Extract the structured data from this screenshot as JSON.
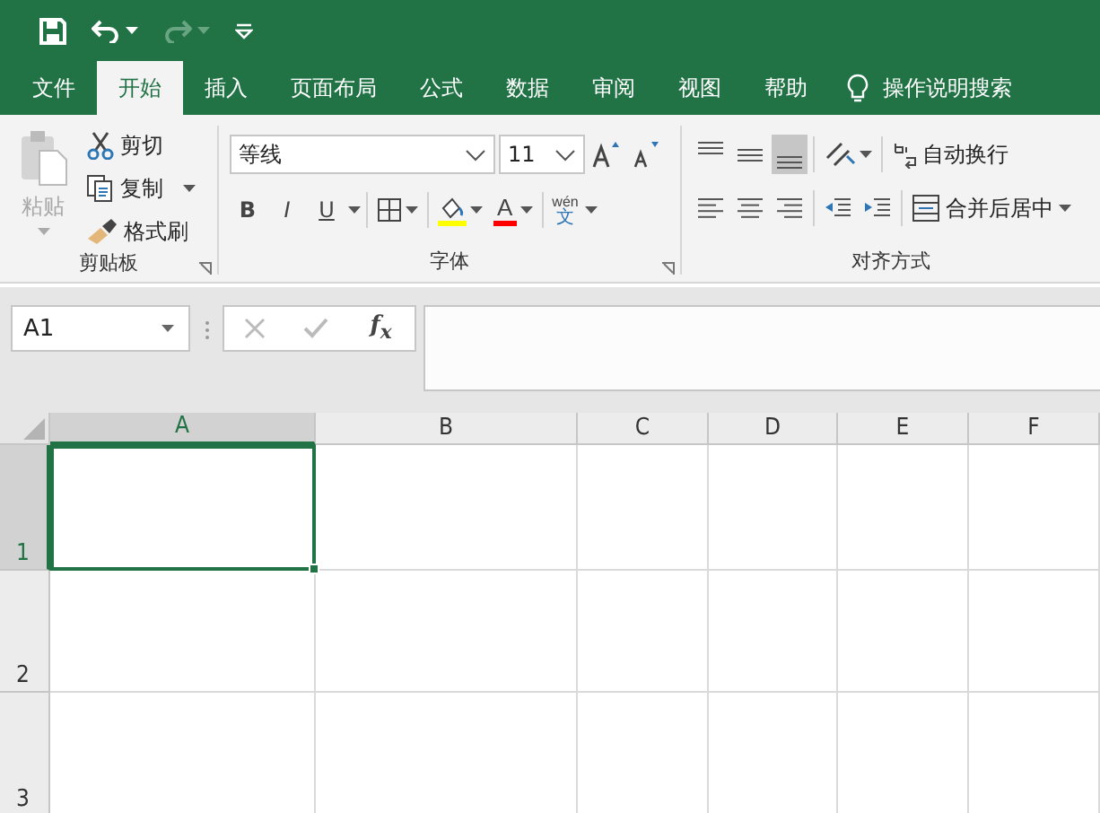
{
  "quick_access": [
    {
      "kind": "save",
      "disabled": false
    },
    {
      "kind": "undo",
      "disabled": false
    },
    {
      "kind": "redo",
      "disabled": true
    },
    {
      "kind": "customize",
      "disabled": false
    }
  ],
  "tabs": [
    {
      "label": "文件",
      "selected": false
    },
    {
      "label": "开始",
      "selected": true
    },
    {
      "label": "插入",
      "selected": false
    },
    {
      "label": "页面布局",
      "selected": false
    },
    {
      "label": "公式",
      "selected": false
    },
    {
      "label": "数据",
      "selected": false
    },
    {
      "label": "审阅",
      "selected": false
    },
    {
      "label": "视图",
      "selected": false
    },
    {
      "label": "帮助",
      "selected": false
    }
  ],
  "search": {
    "label": "操作说明搜索"
  },
  "clipboard": {
    "title": "剪贴板",
    "paste": {
      "label": "粘贴",
      "disabled": true
    },
    "items": [
      {
        "kind": "cut",
        "label": "剪切",
        "dropdown": false
      },
      {
        "kind": "copy",
        "label": "复制",
        "dropdown": true
      },
      {
        "kind": "painter",
        "label": "格式刷",
        "dropdown": false
      }
    ]
  },
  "font": {
    "title": "字体",
    "font_name": "等线",
    "font_size": "11",
    "styles": [
      {
        "label": "B",
        "kind": "bold"
      },
      {
        "label": "I",
        "kind": "italic"
      },
      {
        "label": "U",
        "kind": "underline"
      }
    ],
    "colors": [
      {
        "kind": "fill",
        "color": "#ffff00"
      },
      {
        "kind": "text",
        "label": "A",
        "color": "#ff0000"
      }
    ],
    "phonetic": {
      "top": "wén",
      "bottom": "文"
    }
  },
  "alignment": {
    "title": "对齐方式",
    "vertical": [
      {
        "kind": "top",
        "selected": false
      },
      {
        "kind": "middle",
        "selected": false
      },
      {
        "kind": "bottom",
        "selected": true
      }
    ],
    "wrap": "自动换行",
    "merge": "合并后居中"
  },
  "formula_bar": {
    "name_box": "A1",
    "fx": "f$_{x}$"
  },
  "sheet": {
    "columns": [
      {
        "label": "A",
        "selected": true
      },
      {
        "label": "B",
        "selected": false
      },
      {
        "label": "C",
        "selected": false
      },
      {
        "label": "D",
        "selected": false
      },
      {
        "label": "E",
        "selected": false
      },
      {
        "label": "F",
        "selected": false
      }
    ],
    "rows": [
      {
        "label": "1",
        "selected": true
      },
      {
        "label": "2",
        "selected": false
      },
      {
        "label": "3",
        "selected": false
      }
    ]
  }
}
